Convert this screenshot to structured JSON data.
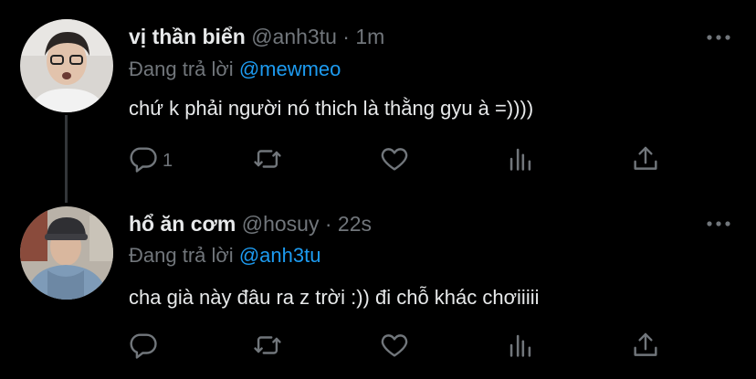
{
  "tweets": [
    {
      "name": "vị thần biển",
      "handle": "@anh3tu",
      "separator": "·",
      "time": "1m",
      "reply_prefix": "Đang trả lời",
      "reply_to": "@mewmeo",
      "text": "chứ k phải người nó thich là thằng gyu à =))))",
      "reply_count": "1",
      "icons": [
        "reply-icon",
        "retweet-icon",
        "like-icon",
        "analytics-icon",
        "share-icon",
        "more-icon"
      ]
    },
    {
      "name": "hổ ăn cơm",
      "handle": "@hosuy",
      "separator": "·",
      "time": "22s",
      "reply_prefix": "Đang trả lời",
      "reply_to": "@anh3tu",
      "text": "cha già này đâu ra z trời :)) đi chỗ khác chơiiiii",
      "reply_count": "",
      "icons": [
        "reply-icon",
        "retweet-icon",
        "like-icon",
        "analytics-icon",
        "share-icon",
        "more-icon"
      ]
    }
  ],
  "colors": {
    "background": "#000000",
    "text": "#e7e9ea",
    "secondary": "#71767b",
    "accent": "#1d9bf0",
    "thread_line": "#333639"
  }
}
